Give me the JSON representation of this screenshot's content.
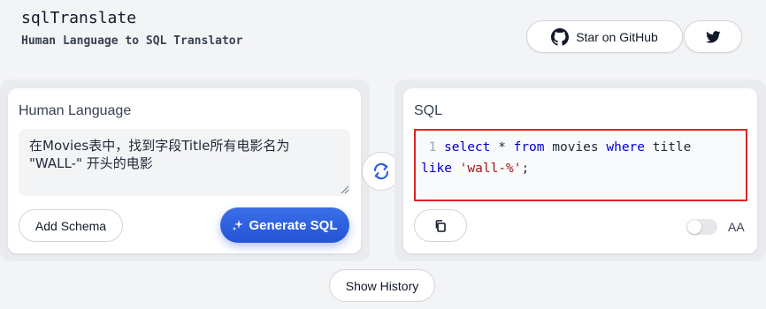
{
  "header": {
    "title": "sqlTranslate",
    "subtitle": "Human Language to SQL Translator",
    "github_label": "Star on GitHub"
  },
  "input_panel": {
    "heading": "Human Language",
    "text": "在Movies表中，找到字段Title所有电影名为 \"WALL-\" 开头的电影",
    "schema_button": "Add Schema",
    "generate_button": "Generate SQL",
    "accent_color": "#2f5fe0"
  },
  "output_panel": {
    "heading": "SQL",
    "line_number": "1",
    "sql": {
      "kw_select": "select",
      "star": " * ",
      "kw_from": "from",
      "table": " movies ",
      "kw_where": "where",
      "col": " title",
      "kw_like": "like",
      "value": "'wall-%'",
      "end": ";"
    },
    "aa_label": "AA",
    "case_toggle_on": false,
    "highlight_color": "#e02424"
  },
  "footer": {
    "history_button": "Show History"
  }
}
